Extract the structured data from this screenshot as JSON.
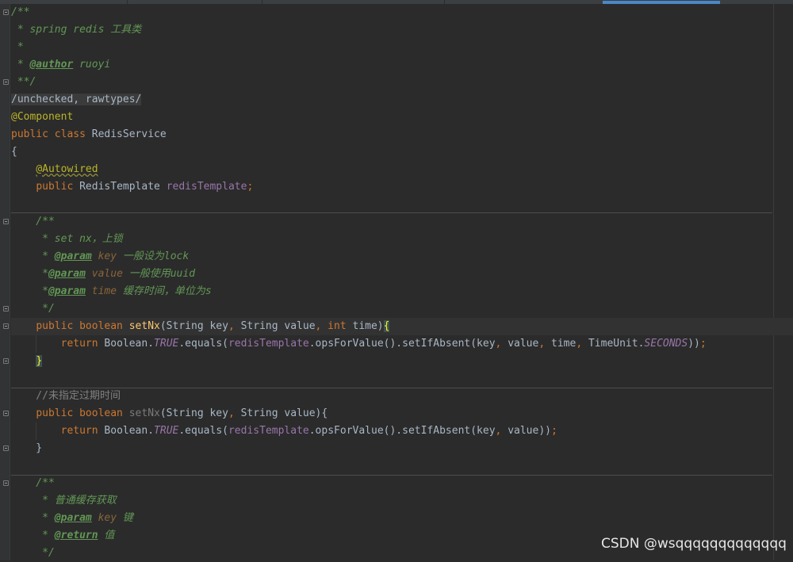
{
  "lines": [
    "/**",
    " * spring redis 工具类",
    " *",
    " * @author ruoyi",
    " **/",
    "/unchecked, rawtypes/",
    "@Component",
    "public class RedisService",
    "{",
    "    @Autowired",
    "    public RedisTemplate redisTemplate;",
    "",
    "    /**",
    "     * set nx，上锁",
    "     * @param key 一般设为lock",
    "     *@param value 一般使用uuid",
    "     *@param time 缓存时间，单位为s",
    "     */",
    "    public boolean setNx(String key, String value, int time){",
    "        return Boolean.TRUE.equals(redisTemplate.opsForValue().setIfAbsent(key, value, time, TimeUnit.SECONDS));",
    "    }",
    "",
    "    //未指定过期时间",
    "    public boolean setNx(String key, String value){",
    "        return Boolean.TRUE.equals(redisTemplate.opsForValue().setIfAbsent(key, value));",
    "    }",
    "",
    "    /**",
    "     * 普通缓存获取",
    "     * @param key 键",
    "     * @return 值",
    "     */"
  ],
  "watermark": "CSDN @wsqqqqqqqqqqqqq",
  "colors": {
    "background": "#2b2b2b",
    "keyword": "#cc7832",
    "doc_comment": "#629755",
    "annotation": "#bbb529",
    "field": "#9876aa",
    "method_declaration": "#ffc66d",
    "line_comment": "#808080",
    "plain_text": "#a9b7c6"
  }
}
